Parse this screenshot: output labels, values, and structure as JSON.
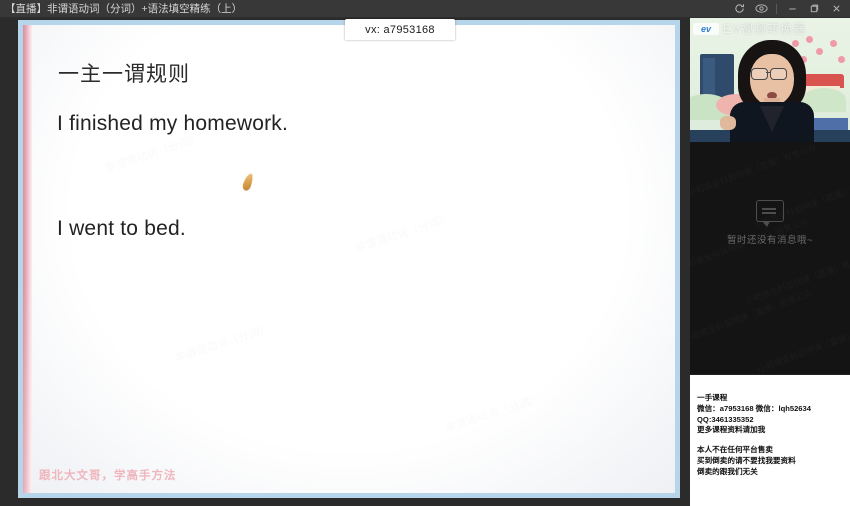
{
  "titlebar": {
    "title": "【直播】非谓语动词（分词）+语法填空精练（上）",
    "refresh_icon": "refresh-icon",
    "eye_icon": "eye-icon",
    "minimize_label": "—",
    "maximize_label": "❐",
    "close_label": "✕"
  },
  "tab": {
    "label": "vx: a7953168"
  },
  "slide": {
    "title": "一主一谓规则",
    "line1": "I finished my homework.",
    "line2": "I went to bed.",
    "footer": "跟北大文哥，学高手方法",
    "cursor_icon": "pen-cursor-icon",
    "watermark": "非谓语动词（分词）"
  },
  "video": {
    "ev_logo_text": "ev",
    "ev_watermark": "EV视频转换器"
  },
  "chat": {
    "empty_icon": "chat-bubble-icon",
    "empty_text": "暂时还没有消息哦~",
    "watermark": "小初高全科目网课（直播）有售公众"
  },
  "contact": {
    "heading": "一手课程",
    "wechat_line": "微信：a7953168  微信：lqh52634",
    "qq_line": "QQ:3461335352",
    "more_line": "更多课程资料请加我",
    "notice1": "本人不在任何平台售卖",
    "notice2": "买到倒卖的请不要找我要资料",
    "notice3": "倒卖的跟我们无关"
  },
  "colors": {
    "titlebar_bg": "#383838",
    "slide_border": "#b6d4ea",
    "accent_pink": "#d78fa0",
    "footer_pink": "#f0b6bd"
  }
}
